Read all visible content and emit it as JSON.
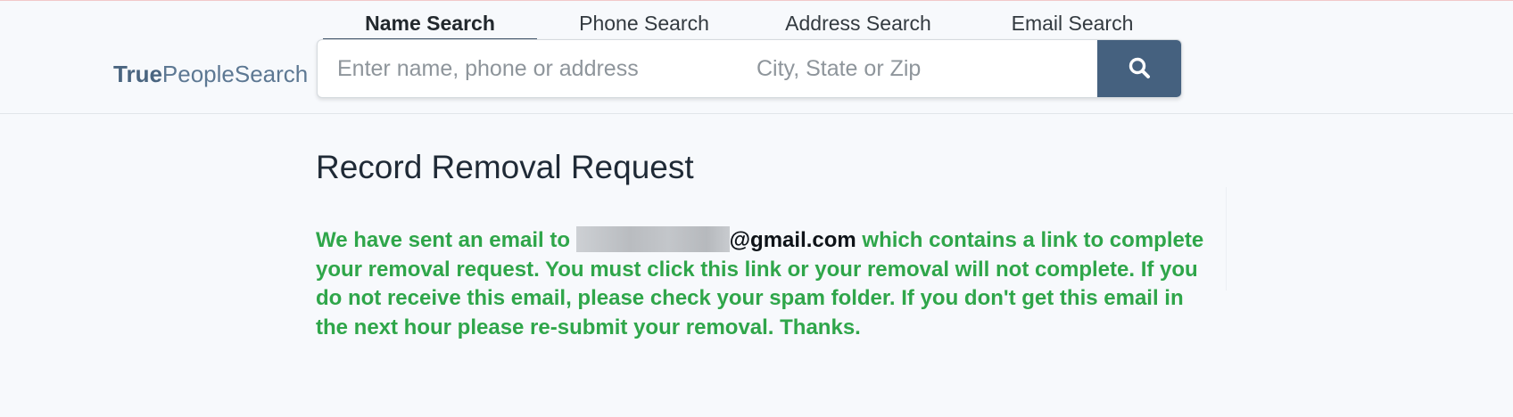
{
  "tabs": [
    {
      "label": "Name Search",
      "active": true
    },
    {
      "label": "Phone Search",
      "active": false
    },
    {
      "label": "Address Search",
      "active": false
    },
    {
      "label": "Email Search",
      "active": false
    }
  ],
  "logo": {
    "strong": "True",
    "rest": "PeopleSearch"
  },
  "search": {
    "name_placeholder": "Enter name, phone or address",
    "location_placeholder": "City, State or Zip",
    "button_icon": "search-icon"
  },
  "page": {
    "title": "Record Removal Request",
    "message_before": "We have sent an email to ",
    "email_domain": "@gmail.com",
    "message_after": " which contains a link to complete your removal request. You must click this link or your removal will not complete. If you do not receive this email, please check your spam folder. If you don't get this email in the next hour please re-submit your removal. Thanks."
  },
  "colors": {
    "brand": "#45617f",
    "message": "#2fa64a",
    "background": "#f7f9fc"
  }
}
